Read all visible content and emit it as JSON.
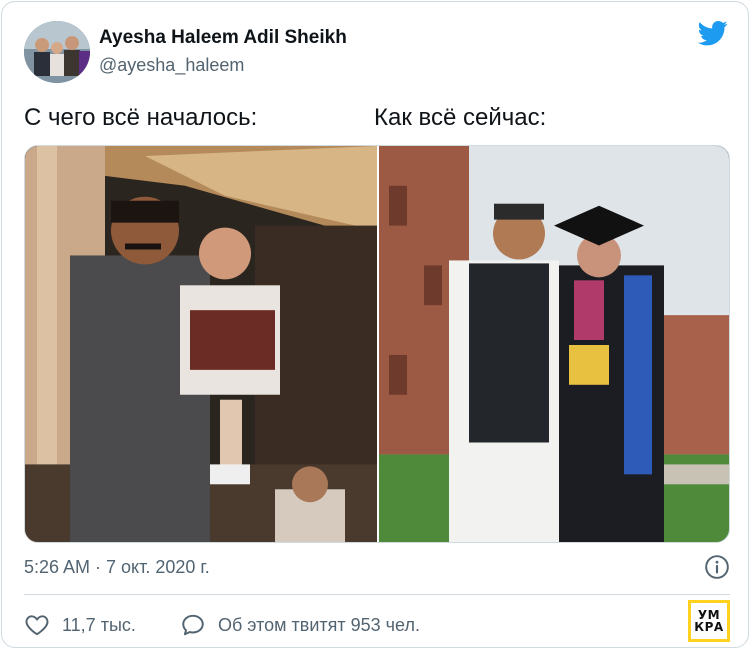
{
  "tweet": {
    "author": {
      "display_name": "Ayesha Haleem Adil Sheikh",
      "handle": "@ayesha_haleem"
    },
    "captions": {
      "left": "С чего всё началось:",
      "right": "Как всё сейчас:"
    },
    "timestamp": "5:26 AM · 7 окт. 2020 г.",
    "actions": {
      "likes_label": "11,7 тыс.",
      "retweets_label": "Об этом твитят 953 чел."
    }
  },
  "watermark": {
    "line1": "УМ",
    "line2": "КРА"
  },
  "colors": {
    "twitter_blue": "#1d9bf0",
    "secondary_text": "#536471",
    "border": "#cfd9de",
    "badge_yellow": "#ffd21f"
  },
  "icons": {
    "brand": "twitter-bird-icon",
    "info": "info-icon",
    "like": "heart-icon",
    "reply": "speech-bubble-icon"
  }
}
